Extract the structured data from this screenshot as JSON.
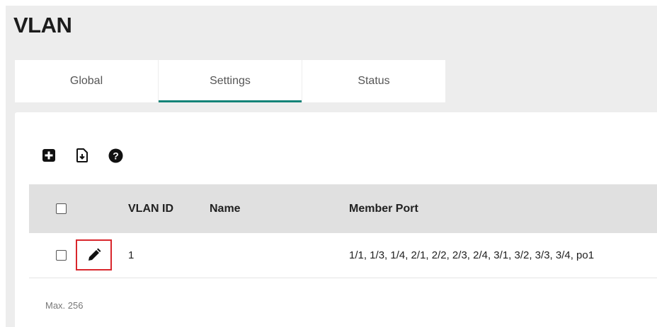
{
  "page": {
    "title": "VLAN"
  },
  "tabs": [
    {
      "label": "Global",
      "active": false
    },
    {
      "label": "Settings",
      "active": true
    },
    {
      "label": "Status",
      "active": false
    }
  ],
  "toolbar": {
    "icons": [
      "add-icon",
      "export-icon",
      "help-icon"
    ]
  },
  "table": {
    "columns": [
      "VLAN ID",
      "Name",
      "Member Port"
    ],
    "rows": [
      {
        "vlan_id": "1",
        "name": "",
        "member_port": "1/1, 1/3, 1/4, 2/1, 2/2, 2/3, 2/4, 3/1, 3/2, 3/3, 3/4, po1"
      }
    ]
  },
  "footer": {
    "max_note": "Max. 256"
  },
  "colors": {
    "accent": "#138378",
    "highlight_box": "#d9262c",
    "header_bg": "#e0e0e0"
  }
}
